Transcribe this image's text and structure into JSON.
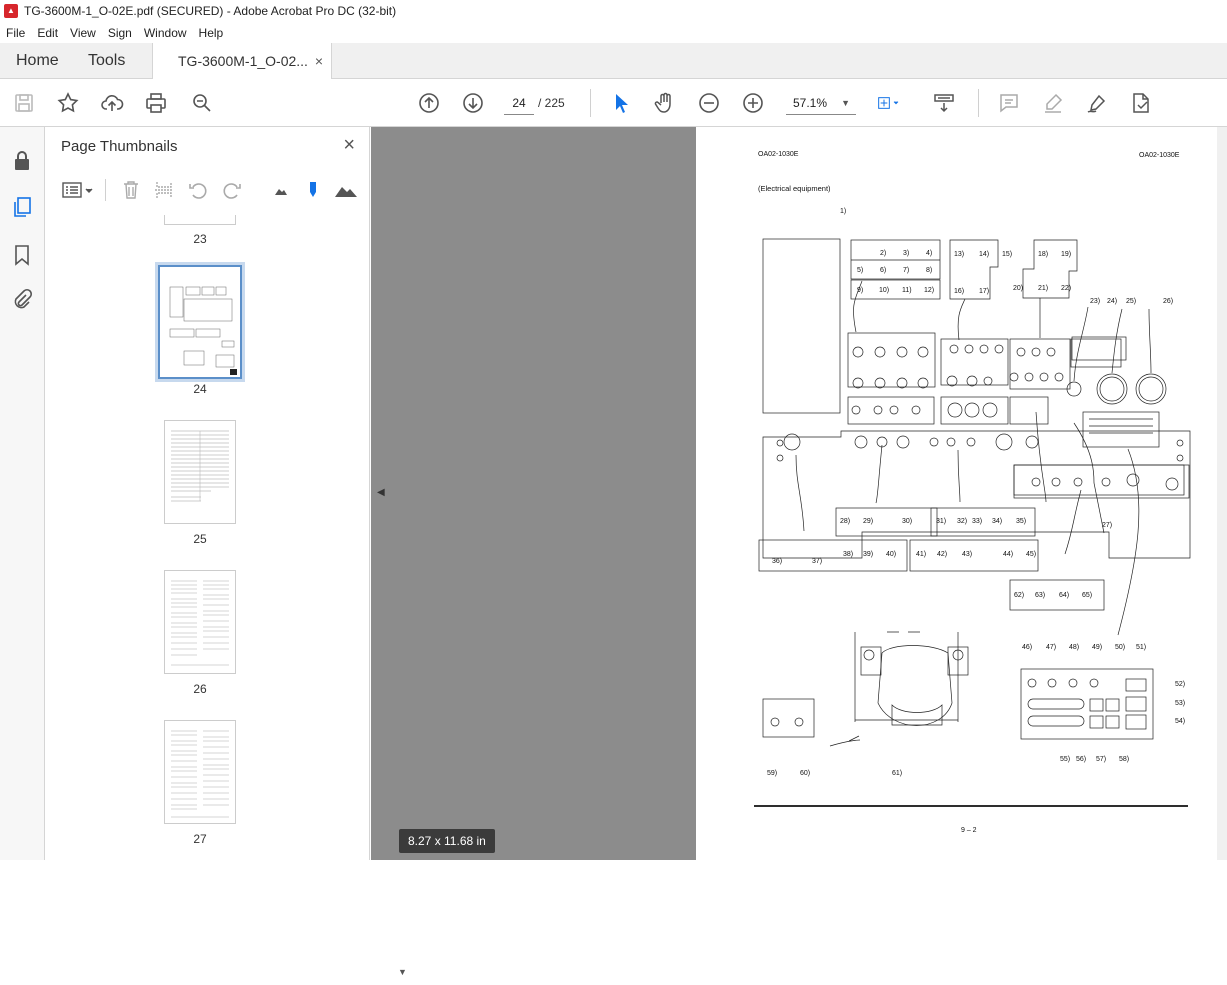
{
  "window": {
    "title": "TG-3600M-1_O-02E.pdf (SECURED) - Adobe Acrobat Pro DC (32-bit)",
    "pdf_icon": "pdf-icon"
  },
  "menu": [
    "File",
    "Edit",
    "View",
    "Sign",
    "Window",
    "Help"
  ],
  "tabs": {
    "home": "Home",
    "tools": "Tools",
    "doc": "TG-3600M-1_O-02...",
    "close": "×"
  },
  "toolbar": {
    "page_current": "24",
    "page_total": "/ 225",
    "zoom": "57.1%"
  },
  "panel": {
    "title": "Page Thumbnails",
    "close": "×"
  },
  "thumbnails": [
    {
      "label": "23"
    },
    {
      "label": "24"
    },
    {
      "label": "25"
    },
    {
      "label": "26"
    },
    {
      "label": "27"
    }
  ],
  "viewer": {
    "page_size": "8.27 x 11.68 in"
  },
  "doc_page": {
    "header_left": "OA02-1030E",
    "header_right": "OA02-1030E",
    "section": "(Electrical equipment)",
    "footer": "9 – 2",
    "callouts": [
      "1)",
      "2)",
      "3)",
      "4)",
      "5)",
      "6)",
      "7)",
      "8)",
      "9)",
      "10)",
      "11)",
      "12)",
      "13)",
      "14)",
      "15)",
      "16)",
      "17)",
      "18)",
      "19)",
      "20)",
      "21)",
      "22)",
      "23)",
      "24)",
      "25)",
      "26)",
      "27)",
      "28)",
      "29)",
      "30)",
      "31)",
      "32)",
      "33)",
      "34)",
      "35)",
      "36)",
      "37)",
      "38)",
      "39)",
      "40)",
      "41)",
      "42)",
      "43)",
      "44)",
      "45)",
      "46)",
      "47)",
      "48)",
      "49)",
      "50)",
      "51)",
      "52)",
      "53)",
      "54)",
      "55)",
      "56)",
      "57)",
      "58)",
      "59)",
      "60)",
      "61)",
      "62)",
      "63)",
      "64)",
      "65)"
    ]
  }
}
